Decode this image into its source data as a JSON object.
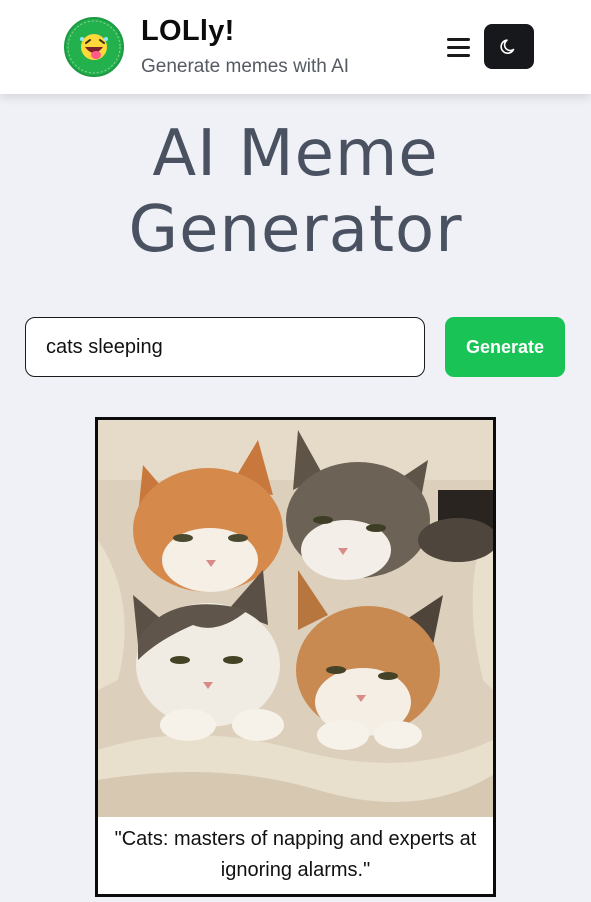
{
  "header": {
    "app_name": "LOLly!",
    "tagline": "Generate memes with AI",
    "logo_icon": "laughing-face-logo",
    "menu_icon": "hamburger-menu-icon",
    "theme_icon": "moon-icon"
  },
  "main": {
    "title_line1": "AI Meme",
    "title_line2": "Generator",
    "search": {
      "value": "cats sleeping",
      "placeholder": ""
    },
    "generate_label": "Generate"
  },
  "meme": {
    "image_subject": "four cats sleeping in blankets",
    "caption": "\"Cats: masters of napping and experts at ignoring alarms.\""
  },
  "colors": {
    "background": "#eff1f6",
    "accent_green": "#19c355",
    "title_color": "#4a5262",
    "dark_button": "#17181b"
  }
}
